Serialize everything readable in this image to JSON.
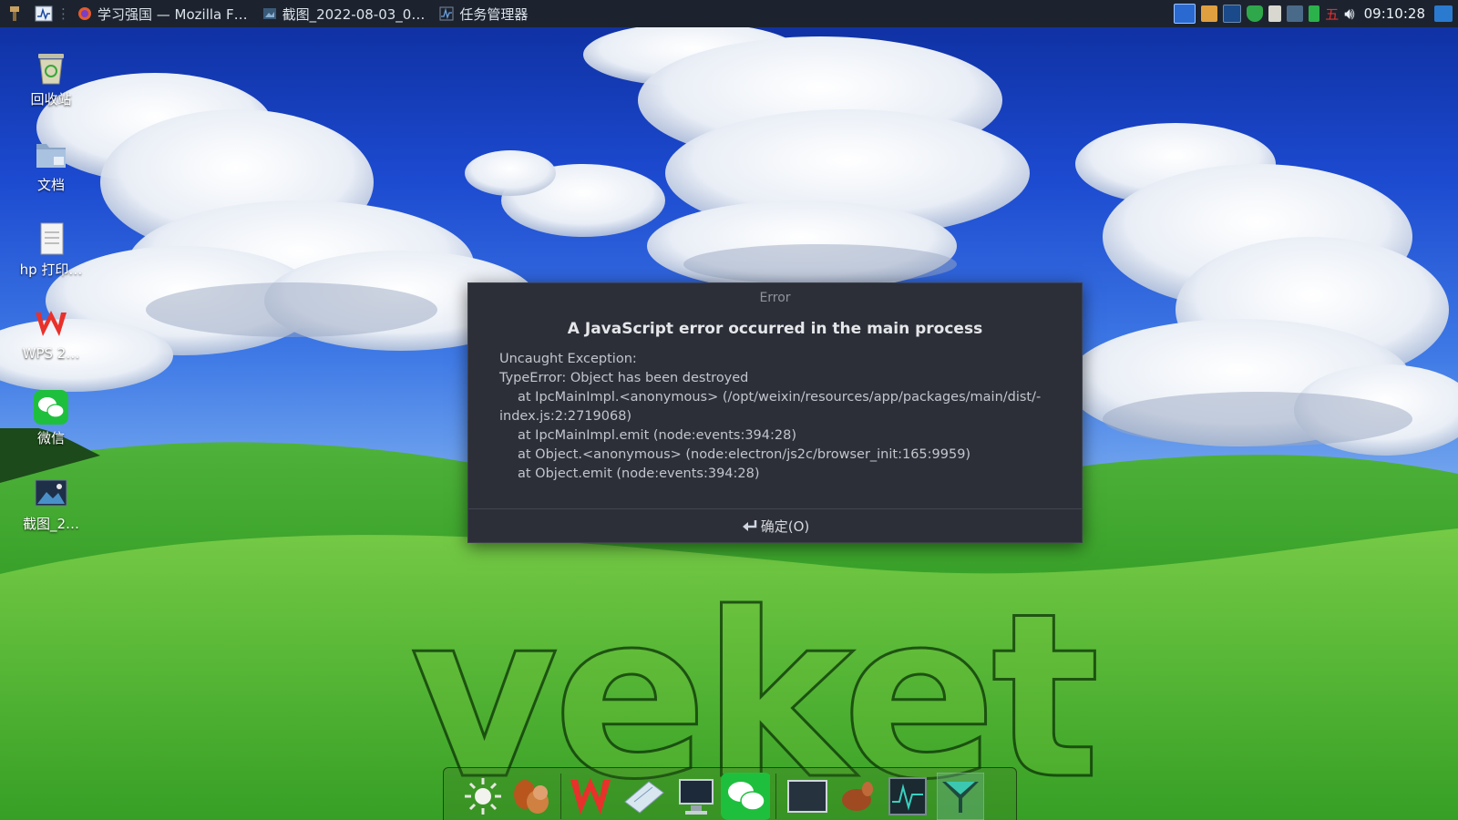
{
  "topbar": {
    "tasks": [
      {
        "label": "学习强国 — Mozilla F…",
        "icon": "firefox-icon"
      },
      {
        "label": "截图_2022-08-03_0…",
        "icon": "screenshot-icon"
      },
      {
        "label": "任务管理器",
        "icon": "task-manager-icon"
      }
    ],
    "tray": {
      "input_method": "五",
      "clock": "09:10:28"
    }
  },
  "desktop_icons": [
    {
      "label": "回收站",
      "icon": "recycle-bin-icon"
    },
    {
      "label": "文档",
      "icon": "documents-folder-icon"
    },
    {
      "label": "hp 打印…",
      "icon": "text-file-icon"
    },
    {
      "label": "WPS 2…",
      "icon": "wps-icon"
    },
    {
      "label": "微信",
      "icon": "wechat-icon"
    },
    {
      "label": "截图_2…",
      "icon": "image-file-icon"
    }
  ],
  "dialog": {
    "title": "Error",
    "heading": "A JavaScript error occurred in the main process",
    "lines": [
      "Uncaught Exception:",
      "TypeError: Object has been destroyed",
      "at IpcMainImpl.<anonymous> (/opt/weixin/resources/app/packages/main/dist/-",
      "index.js:2:2719068)",
      "at IpcMainImpl.emit (node:events:394:28)",
      "at Object.<anonymous> (node:electron/js2c/browser_init:165:9959)",
      "at Object.emit (node:events:394:28)"
    ],
    "ok_button": "确定(O)"
  },
  "wallpaper": {
    "text": "veket"
  },
  "dock": {
    "items": [
      "brightness-icon",
      "squirrel-app-icon",
      "wps-icon",
      "notepad-icon",
      "computer-icon",
      "wechat-icon",
      "terminal-icon",
      "hand-icon",
      "system-monitor-icon",
      "network-icon"
    ]
  },
  "colors": {
    "topbar_bg": "#1c232e",
    "dialog_bg": "#2d2f38",
    "accent_green": "#1fbf3e",
    "wps_red": "#e8312a"
  }
}
